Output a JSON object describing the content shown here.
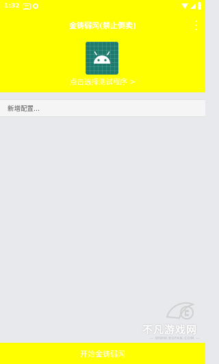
{
  "status_bar": {
    "time": "1:32"
  },
  "header": {
    "title": "金铸弱网(禁止倒卖)",
    "select_link": "点击选择测试程序 >"
  },
  "config": {
    "new_config_label": "新增配置..."
  },
  "watermark": {
    "text": "不凡游戏网",
    "subtext": "— WWW.BUFAN.COM —"
  },
  "footer": {
    "start_button_label": "开始金铸弱网"
  },
  "colors": {
    "accent": "#ffff00",
    "icon_bg": "#1e7a6c",
    "list_bg": "#e8e9ed"
  }
}
